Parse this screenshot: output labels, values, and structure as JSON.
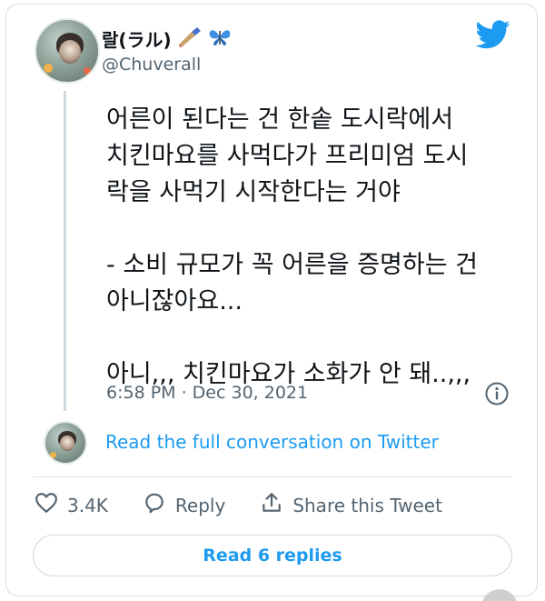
{
  "author": {
    "display_name": "랄(ラル)",
    "handle": "@Chuverall",
    "name_emojis": [
      "paintbrush-icon",
      "butterfly-icon"
    ]
  },
  "tweet": {
    "text": "어른이 된다는 건 한솥 도시락에서\n치킨마요를 사먹다가 프리미엄 도시\n락을 사먹기 시작한다는 거야\n\n- 소비 규모가 꼭 어른을 증명하는 건\n아니잖아요...\n\n아니,,, 치킨마요가 소화가 안 돼..,,,",
    "timestamp": "6:58 PM · Dec 30, 2021"
  },
  "conversation": {
    "read_full_label": "Read the full conversation on Twitter"
  },
  "actions": {
    "like_count": "3.4K",
    "reply_label": "Reply",
    "share_label": "Share this Tweet"
  },
  "replies_button": {
    "label": "Read 6 replies"
  },
  "colors": {
    "twitter_blue": "#1d9bf0",
    "secondary_text": "#536471"
  }
}
